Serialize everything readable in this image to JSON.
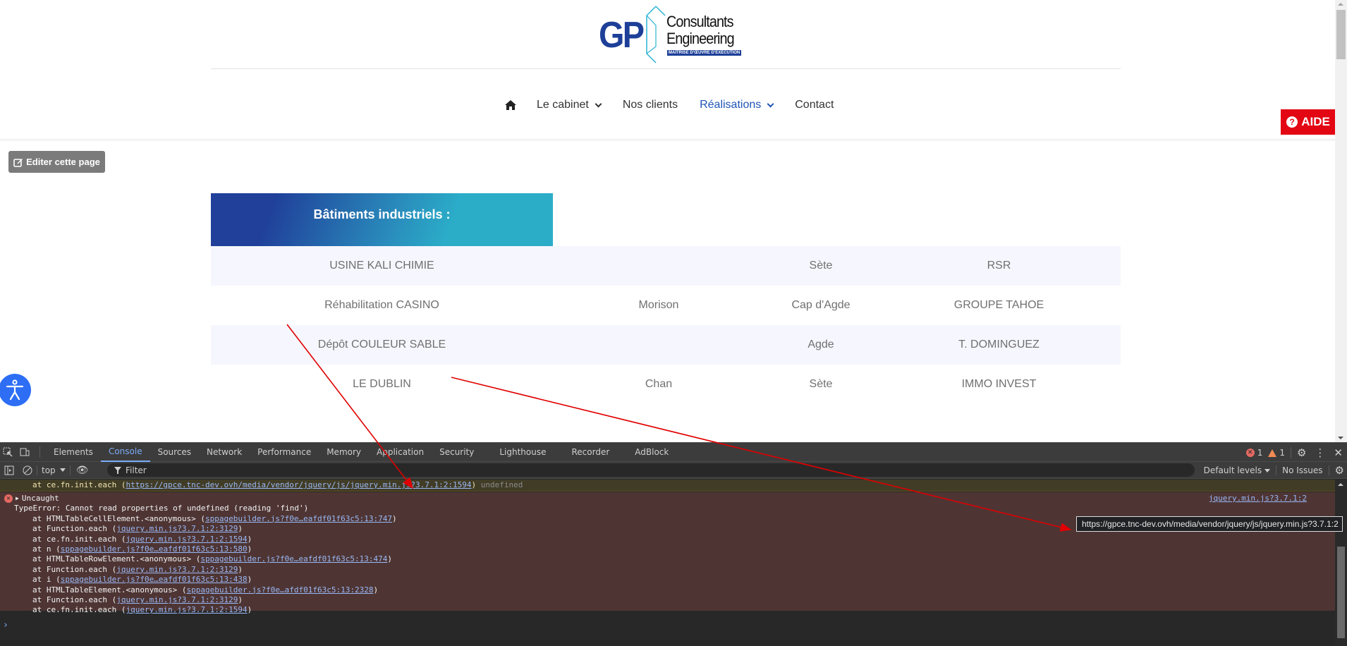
{
  "site": {
    "logo": {
      "gp": "GP",
      "line1": "Consultants",
      "line2": "Engineering",
      "tagline": "MAÎTRISE D'ŒUVRE D'EXÉCUTION"
    },
    "nav": {
      "home_icon": "home-icon",
      "items": [
        {
          "label": "Le cabinet",
          "dropdown": true,
          "active": false
        },
        {
          "label": "Nos clients",
          "dropdown": false,
          "active": false
        },
        {
          "label": "Réalisations",
          "dropdown": true,
          "active": true
        },
        {
          "label": "Contact",
          "dropdown": false,
          "active": false
        }
      ],
      "active_color": "#1f54b7"
    },
    "help_button": {
      "label": "AIDE",
      "icon": "question-circle-icon",
      "color": "#e30613"
    },
    "edit_button": {
      "label": "Editer cette page",
      "icon": "edit-icon"
    },
    "section_title": "Bâtiments industriels :",
    "table": {
      "rows": [
        [
          "USINE KALI CHIMIE",
          "",
          "Sète",
          "RSR"
        ],
        [
          "Réhabilitation CASINO",
          "Morison",
          "Cap d'Agde",
          "GROUPE TAHOE"
        ],
        [
          "Dépôt COULEUR SABLE",
          "",
          "Agde",
          "T. DOMINGUEZ"
        ],
        [
          "LE DUBLIN",
          "Chan",
          "Sète",
          "IMMO INVEST"
        ]
      ]
    },
    "accessibility_button": {
      "icon": "accessibility-icon",
      "color": "#2d6ef5"
    }
  },
  "devtools": {
    "tabs": [
      "Elements",
      "Console",
      "Sources",
      "Network",
      "Performance",
      "Memory",
      "Application",
      "Security",
      "Lighthouse",
      "Recorder",
      "AdBlock"
    ],
    "active_tab": "Console",
    "error_count": "1",
    "warning_count": "1",
    "toolbar": {
      "context": "top",
      "filter_placeholder": "Filter",
      "levels": "Default levels",
      "issues": "No Issues"
    },
    "console": {
      "warning_line": {
        "prefix": "at ce.fn.init.each (",
        "link": "https://gpce.tnc-dev.ovh/media/vendor/jquery/js/jquery.min.js?3.7.1:2:1594",
        "suffix": ")",
        "trailing": "undefined"
      },
      "error": {
        "header": "Uncaught",
        "source": "jquery.min.js?3.7.1:2",
        "message": "TypeError: Cannot read properties of undefined (reading 'find')",
        "stack": [
          {
            "fn": "at HTMLTableCellElement.<anonymous> (",
            "link": "sppagebuilder.js?f0e…eafdf01f63c5:13:747"
          },
          {
            "fn": "at Function.each (",
            "link": "jquery.min.js?3.7.1:2:3129"
          },
          {
            "fn": "at ce.fn.init.each (",
            "link": "jquery.min.js?3.7.1:2:1594"
          },
          {
            "fn": "at n (",
            "link": "sppagebuilder.js?f0e…eafdf01f63c5:13:580"
          },
          {
            "fn": "at HTMLTableRowElement.<anonymous> (",
            "link": "sppagebuilder.js?f0e…eafdf01f63c5:13:474"
          },
          {
            "fn": "at Function.each (",
            "link": "jquery.min.js?3.7.1:2:3129"
          },
          {
            "fn": "at i (",
            "link": "sppagebuilder.js?f0e…eafdf01f63c5:13:438"
          },
          {
            "fn": "at HTMLTableElement.<anonymous> (",
            "link": "sppagebuilder.js?f0e…afdf01f63c5:13:2328"
          },
          {
            "fn": "at Function.each (",
            "link": "jquery.min.js?3.7.1:2:3129"
          },
          {
            "fn": "at ce.fn.init.each (",
            "link": "jquery.min.js?3.7.1:2:1594"
          }
        ]
      },
      "prompt": "›"
    },
    "tooltip": "https://gpce.tnc-dev.ovh/media/vendor/jquery/js/jquery.min.js?3.7.1:2"
  }
}
